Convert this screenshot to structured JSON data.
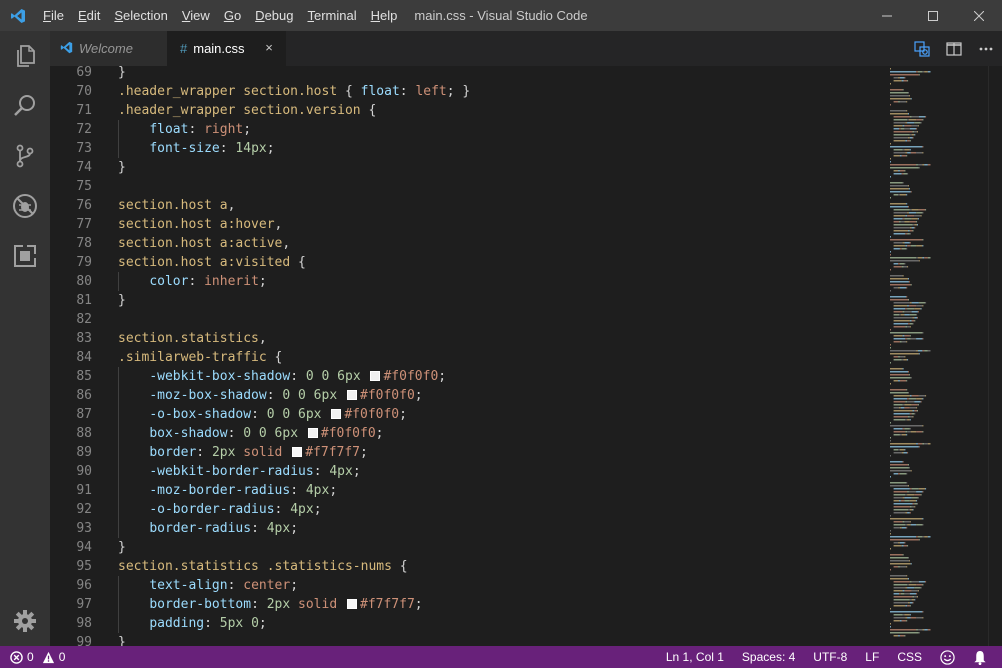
{
  "window": {
    "title": "main.css - Visual Studio Code"
  },
  "menu": [
    {
      "label": "File",
      "acc": "F",
      "rest": "ile"
    },
    {
      "label": "Edit",
      "acc": "E",
      "rest": "dit"
    },
    {
      "label": "Selection",
      "acc": "S",
      "rest": "election"
    },
    {
      "label": "View",
      "acc": "V",
      "rest": "iew"
    },
    {
      "label": "Go",
      "acc": "G",
      "rest": "o"
    },
    {
      "label": "Debug",
      "acc": "D",
      "rest": "ebug"
    },
    {
      "label": "Terminal",
      "acc": "T",
      "rest": "erminal"
    },
    {
      "label": "Help",
      "acc": "H",
      "rest": "elp"
    }
  ],
  "activity": [
    "files-icon",
    "search-icon",
    "source-control-icon",
    "debug-icon",
    "extensions-icon",
    "settings-gear-icon"
  ],
  "tabs": {
    "welcome": "Welcome",
    "main": "main.css",
    "main_icon": "#",
    "close": "×"
  },
  "code_lines": [
    {
      "n": "69",
      "t": [
        [
          "punc",
          "}"
        ]
      ]
    },
    {
      "n": "70",
      "t": [
        [
          "sel",
          ".header_wrapper section.host "
        ],
        [
          "punc",
          "{ "
        ],
        [
          "prop",
          "float"
        ],
        [
          "punc",
          ": "
        ],
        [
          "val",
          "left"
        ],
        [
          "punc",
          "; }"
        ]
      ]
    },
    {
      "n": "71",
      "t": [
        [
          "sel",
          ".header_wrapper section.version "
        ],
        [
          "punc",
          "{"
        ]
      ]
    },
    {
      "n": "72",
      "t": [
        [
          "punc",
          "    "
        ],
        [
          "prop",
          "float"
        ],
        [
          "punc",
          ": "
        ],
        [
          "val",
          "right"
        ],
        [
          "punc",
          ";"
        ]
      ]
    },
    {
      "n": "73",
      "t": [
        [
          "punc",
          "    "
        ],
        [
          "prop",
          "font-size"
        ],
        [
          "punc",
          ": "
        ],
        [
          "num",
          "14px"
        ],
        [
          "punc",
          ";"
        ]
      ]
    },
    {
      "n": "74",
      "t": [
        [
          "punc",
          "}"
        ]
      ]
    },
    {
      "n": "75",
      "t": []
    },
    {
      "n": "76",
      "t": [
        [
          "sel",
          "section.host a"
        ],
        [
          "punc",
          ","
        ]
      ]
    },
    {
      "n": "77",
      "t": [
        [
          "sel",
          "section.host a:hover"
        ],
        [
          "punc",
          ","
        ]
      ]
    },
    {
      "n": "78",
      "t": [
        [
          "sel",
          "section.host a:active"
        ],
        [
          "punc",
          ","
        ]
      ]
    },
    {
      "n": "79",
      "t": [
        [
          "sel",
          "section.host a:visited "
        ],
        [
          "punc",
          "{"
        ]
      ]
    },
    {
      "n": "80",
      "t": [
        [
          "punc",
          "    "
        ],
        [
          "prop",
          "color"
        ],
        [
          "punc",
          ": "
        ],
        [
          "val",
          "inherit"
        ],
        [
          "punc",
          ";"
        ]
      ]
    },
    {
      "n": "81",
      "t": [
        [
          "punc",
          "}"
        ]
      ]
    },
    {
      "n": "82",
      "t": []
    },
    {
      "n": "83",
      "t": [
        [
          "sel",
          "section.statistics"
        ],
        [
          "punc",
          ","
        ]
      ]
    },
    {
      "n": "84",
      "t": [
        [
          "sel",
          ".similarweb-traffic "
        ],
        [
          "punc",
          "{"
        ]
      ]
    },
    {
      "n": "85",
      "t": [
        [
          "punc",
          "    "
        ],
        [
          "prop",
          "-webkit-box-shadow"
        ],
        [
          "punc",
          ": "
        ],
        [
          "num",
          "0 0 6px "
        ],
        [
          "swatch",
          "#f0f0f0"
        ],
        [
          "val",
          "#f0f0f0"
        ],
        [
          "punc",
          ";"
        ]
      ]
    },
    {
      "n": "86",
      "t": [
        [
          "punc",
          "    "
        ],
        [
          "prop",
          "-moz-box-shadow"
        ],
        [
          "punc",
          ": "
        ],
        [
          "num",
          "0 0 6px "
        ],
        [
          "swatch",
          "#f0f0f0"
        ],
        [
          "val",
          "#f0f0f0"
        ],
        [
          "punc",
          ";"
        ]
      ]
    },
    {
      "n": "87",
      "t": [
        [
          "punc",
          "    "
        ],
        [
          "prop",
          "-o-box-shadow"
        ],
        [
          "punc",
          ": "
        ],
        [
          "num",
          "0 0 6px "
        ],
        [
          "swatch",
          "#f0f0f0"
        ],
        [
          "val",
          "#f0f0f0"
        ],
        [
          "punc",
          ";"
        ]
      ]
    },
    {
      "n": "88",
      "t": [
        [
          "punc",
          "    "
        ],
        [
          "prop",
          "box-shadow"
        ],
        [
          "punc",
          ": "
        ],
        [
          "num",
          "0 0 6px "
        ],
        [
          "swatch",
          "#f0f0f0"
        ],
        [
          "val",
          "#f0f0f0"
        ],
        [
          "punc",
          ";"
        ]
      ]
    },
    {
      "n": "89",
      "t": [
        [
          "punc",
          "    "
        ],
        [
          "prop",
          "border"
        ],
        [
          "punc",
          ": "
        ],
        [
          "num",
          "2px "
        ],
        [
          "val",
          "solid "
        ],
        [
          "swatch",
          "#f7f7f7"
        ],
        [
          "val",
          "#f7f7f7"
        ],
        [
          "punc",
          ";"
        ]
      ]
    },
    {
      "n": "90",
      "t": [
        [
          "punc",
          "    "
        ],
        [
          "prop",
          "-webkit-border-radius"
        ],
        [
          "punc",
          ": "
        ],
        [
          "num",
          "4px"
        ],
        [
          "punc",
          ";"
        ]
      ]
    },
    {
      "n": "91",
      "t": [
        [
          "punc",
          "    "
        ],
        [
          "prop",
          "-moz-border-radius"
        ],
        [
          "punc",
          ": "
        ],
        [
          "num",
          "4px"
        ],
        [
          "punc",
          ";"
        ]
      ]
    },
    {
      "n": "92",
      "t": [
        [
          "punc",
          "    "
        ],
        [
          "prop",
          "-o-border-radius"
        ],
        [
          "punc",
          ": "
        ],
        [
          "num",
          "4px"
        ],
        [
          "punc",
          ";"
        ]
      ]
    },
    {
      "n": "93",
      "t": [
        [
          "punc",
          "    "
        ],
        [
          "prop",
          "border-radius"
        ],
        [
          "punc",
          ": "
        ],
        [
          "num",
          "4px"
        ],
        [
          "punc",
          ";"
        ]
      ]
    },
    {
      "n": "94",
      "t": [
        [
          "punc",
          "}"
        ]
      ]
    },
    {
      "n": "95",
      "t": [
        [
          "sel",
          "section.statistics .statistics-nums "
        ],
        [
          "punc",
          "{"
        ]
      ]
    },
    {
      "n": "96",
      "t": [
        [
          "punc",
          "    "
        ],
        [
          "prop",
          "text-align"
        ],
        [
          "punc",
          ": "
        ],
        [
          "val",
          "center"
        ],
        [
          "punc",
          ";"
        ]
      ]
    },
    {
      "n": "97",
      "t": [
        [
          "punc",
          "    "
        ],
        [
          "prop",
          "border-bottom"
        ],
        [
          "punc",
          ": "
        ],
        [
          "num",
          "2px "
        ],
        [
          "val",
          "solid "
        ],
        [
          "swatch",
          "#f7f7f7"
        ],
        [
          "val",
          "#f7f7f7"
        ],
        [
          "punc",
          ";"
        ]
      ]
    },
    {
      "n": "98",
      "t": [
        [
          "punc",
          "    "
        ],
        [
          "prop",
          "padding"
        ],
        [
          "punc",
          ": "
        ],
        [
          "num",
          "5px 0"
        ],
        [
          "punc",
          ";"
        ]
      ]
    },
    {
      "n": "99",
      "t": [
        [
          "punc",
          "}"
        ]
      ]
    }
  ],
  "statusbar": {
    "errors": "0",
    "warnings": "0",
    "position": "Ln 1, Col 1",
    "spaces": "Spaces: 4",
    "encoding": "UTF-8",
    "eol": "LF",
    "language": "CSS"
  },
  "colors": {
    "statusbar": "#68217a",
    "titlebar": "#3c3c3c",
    "activitybar": "#333333",
    "editor": "#1e1e1e"
  }
}
